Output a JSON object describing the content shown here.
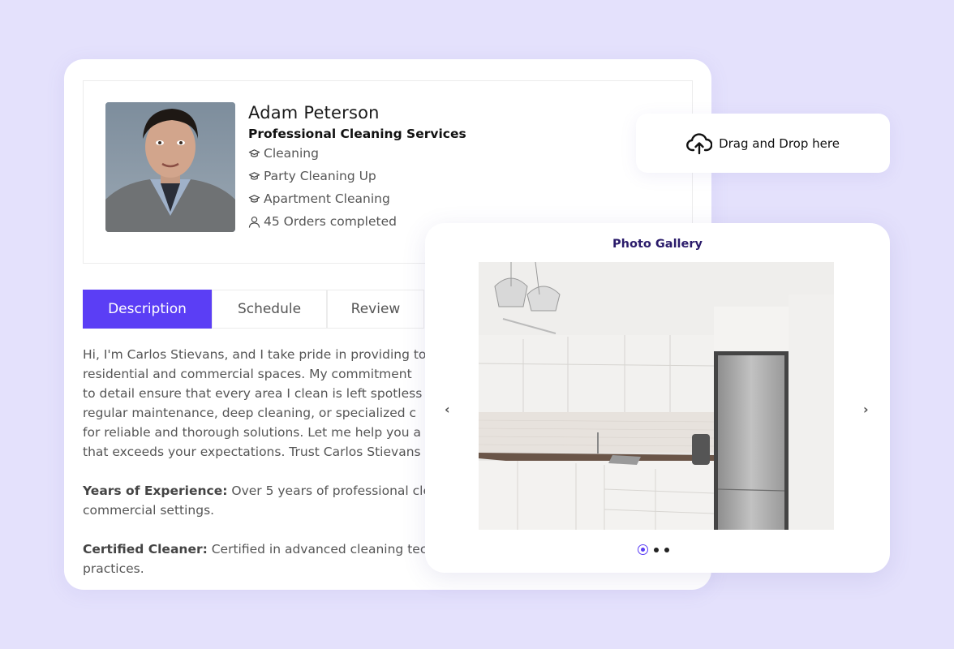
{
  "profile": {
    "name": "Adam Peterson",
    "headline": "Professional Cleaning Services",
    "skills": [
      {
        "icon": "graduation-cap-icon",
        "label": "Cleaning"
      },
      {
        "icon": "graduation-cap-icon",
        "label": "Party Cleaning Up"
      },
      {
        "icon": "graduation-cap-icon",
        "label": "Apartment Cleaning"
      }
    ],
    "orders": {
      "icon": "user-icon",
      "label": "45 Orders completed"
    }
  },
  "tabs": [
    {
      "label": "Description",
      "active": true
    },
    {
      "label": "Schedule",
      "active": false
    },
    {
      "label": "Review",
      "active": false
    }
  ],
  "description": {
    "intro_lines": [
      "Hi, I'm Carlos Stievans, and I take pride in providing to",
      "residential and commercial spaces. My commitment",
      "to detail ensure that every area I clean is left spotless",
      "regular maintenance, deep cleaning, or specialized c",
      "for reliable and thorough solutions. Let me help you a",
      "that exceeds your expectations. Trust Carlos Stievans"
    ],
    "experience": {
      "label": "Years of Experience:",
      "line1": " Over 5 years of professional cle",
      "line2": "commercial settings."
    },
    "certified": {
      "label": "Certified Cleaner:",
      "line1": " Certified in advanced cleaning tec",
      "line2": "practices."
    }
  },
  "upload": {
    "icon": "cloud-upload-icon",
    "label": "Drag and Drop here"
  },
  "gallery": {
    "title": "Photo Gallery",
    "prev_icon": "‹",
    "next_icon": "›",
    "slide_count": 3,
    "active_slide": 1,
    "accent": "#5b3ef5"
  },
  "colors": {
    "background": "#e4e1fc",
    "accent": "#5b3ef5",
    "gallery_title": "#2b1c6b"
  }
}
